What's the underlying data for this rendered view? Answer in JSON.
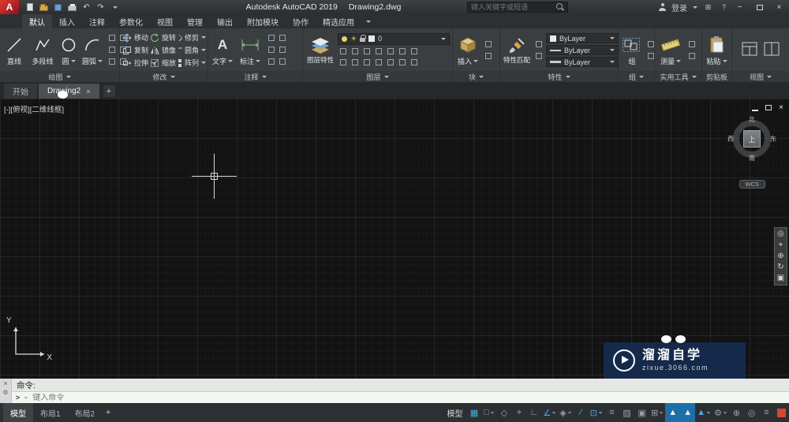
{
  "titlebar": {
    "app_name": "Autodesk AutoCAD 2019",
    "doc_name": "Drawing2.dwg",
    "search_placeholder": "键入关键字或短语",
    "signin": "登录"
  },
  "icons": {
    "close": "×",
    "minimize": "−",
    "undo": "↶",
    "redo": "↷",
    "plus": "+",
    "apps": "⊞",
    "help": "?",
    "gear": "⚙",
    "sun": "☀",
    "text_glyph": "A"
  },
  "ribbon_tabs": [
    {
      "label": "默认"
    },
    {
      "label": "插入"
    },
    {
      "label": "注释"
    },
    {
      "label": "参数化"
    },
    {
      "label": "视图"
    },
    {
      "label": "管理"
    },
    {
      "label": "输出"
    },
    {
      "label": "附加模块"
    },
    {
      "label": "协作"
    },
    {
      "label": "精选应用"
    }
  ],
  "panels": {
    "draw": {
      "label": "绘图",
      "line": "直线",
      "polyline": "多段线",
      "circle": "圆",
      "arc": "圆弧"
    },
    "modify": {
      "label": "修改",
      "move": "移动",
      "rotate": "旋转",
      "trim": "修剪",
      "copy": "复制",
      "mirror": "镜像",
      "fillet": "圆角",
      "stretch": "拉伸",
      "scale": "缩放",
      "array": "阵列"
    },
    "annotate": {
      "label": "注释",
      "text": "文字",
      "dimension": "标注"
    },
    "layers": {
      "label": "图层",
      "properties_btn": "图层特性",
      "current": "0"
    },
    "block": {
      "label": "块",
      "insert": "插入"
    },
    "properties": {
      "label": "特性",
      "match": "特性匹配",
      "color": "ByLayer",
      "linetype": "ByLayer",
      "lineweight": "ByLayer"
    },
    "groups": {
      "label": "组",
      "group": "组"
    },
    "utilities": {
      "label": "实用工具",
      "measure": "测量"
    },
    "clipboard": {
      "label": "剪贴板",
      "paste": "粘贴"
    },
    "view": {
      "label": "视图"
    }
  },
  "file_tabs": {
    "start": "开始",
    "active": "Drawing2"
  },
  "viewport": {
    "controls_label": "[-][俯视][二维线框]",
    "viewcube": {
      "north": "北",
      "south": "南",
      "west": "西",
      "east": "东",
      "top": "上"
    },
    "wcs_label": "WCS",
    "axis_x": "X",
    "axis_y": "Y"
  },
  "nav_icons": [
    {
      "name": "steering-wheel-icon",
      "glyph": "◎"
    },
    {
      "name": "pan-icon",
      "glyph": "⌖"
    },
    {
      "name": "zoom-icon",
      "glyph": "⊕"
    },
    {
      "name": "orbit-icon",
      "glyph": "↻"
    },
    {
      "name": "showmotion-icon",
      "glyph": "▣"
    }
  ],
  "command": {
    "prompt": "命令:",
    "placeholder": "键入命令"
  },
  "statusbar": {
    "model_tab": "模型",
    "layout1": "布局1",
    "layout2": "布局2",
    "new_layout": "+",
    "model_badge": "模型"
  },
  "status_icons": [
    {
      "name": "grid-toggle",
      "glyph": "▦",
      "active": true
    },
    {
      "name": "snap-toggle",
      "glyph": "□",
      "active": false
    },
    {
      "name": "infer-constraints-toggle",
      "glyph": "◇",
      "active": false
    },
    {
      "name": "dynamic-input-toggle",
      "glyph": "⌖",
      "active": false
    },
    {
      "name": "ortho-toggle",
      "glyph": "∟",
      "active": false
    },
    {
      "name": "polar-tracking-toggle",
      "glyph": "∠",
      "active": true
    },
    {
      "name": "isodraft-toggle",
      "glyph": "◈",
      "active": false
    },
    {
      "name": "object-snap-tracking-toggle",
      "glyph": "∕",
      "active": true
    },
    {
      "name": "object-snap-toggle",
      "glyph": "⊡",
      "active": true
    },
    {
      "name": "lineweight-toggle",
      "glyph": "≡",
      "active": false
    },
    {
      "name": "transparency-toggle",
      "glyph": "▨",
      "active": false
    },
    {
      "name": "selection-cycling-toggle",
      "glyph": "▣",
      "active": false
    },
    {
      "name": "3d-osnap-toggle",
      "glyph": "⊞",
      "active": false
    },
    {
      "name": "annotation-visibility-toggle",
      "glyph": "▲",
      "active": true
    },
    {
      "name": "annotation-autoscale-toggle",
      "glyph": "▲",
      "active": true
    },
    {
      "name": "annotation-scale-button",
      "glyph": "▲",
      "active": true
    },
    {
      "name": "workspace-switching-button",
      "glyph": "⚙",
      "active": false
    },
    {
      "name": "annotation-monitor-toggle",
      "glyph": "⊕",
      "active": false
    },
    {
      "name": "isolate-objects-button",
      "glyph": "◎",
      "active": false
    },
    {
      "name": "customize-button",
      "glyph": "≡",
      "active": false
    }
  ],
  "watermark": {
    "name": "溜溜自学",
    "site": "zixue.3066.com"
  },
  "colors": {
    "accent_blue": "#4fa8e0",
    "close_red": "#d2482e",
    "logo_red": "#c21325",
    "watermark_navy": "#15294b"
  }
}
